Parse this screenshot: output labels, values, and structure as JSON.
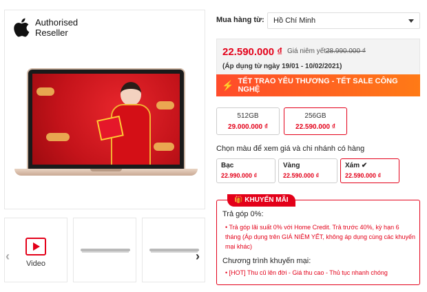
{
  "reseller": {
    "line1": "Authorised",
    "line2": "Reseller"
  },
  "thumbs": {
    "video_label": "Video"
  },
  "store": {
    "label": "Mua hàng từ:",
    "value": "Hồ Chí Minh"
  },
  "price": {
    "main": "22.590.000 ₫",
    "list_label": "Giá niêm yết :",
    "list_value": "28.990.000 ₫",
    "apply_note": "(Áp dụng từ ngày 19/01 - 10/02/2021)"
  },
  "banner": {
    "text": "TẾT TRAO YÊU THƯƠNG - TẾT SALE CÔNG NGHỆ"
  },
  "options": [
    {
      "name": "512GB",
      "price": "29.000.000 ₫"
    },
    {
      "name": "256GB",
      "price": "22.590.000 ₫"
    }
  ],
  "color_label": "Chọn màu để xem giá và chi nhánh có hàng",
  "colors": [
    {
      "name": "Bạc",
      "price": "22.990.000 ₫"
    },
    {
      "name": "Vàng",
      "price": "22.590.000 ₫"
    },
    {
      "name": "Xám ✔",
      "price": "22.590.000 ₫"
    }
  ],
  "promo": {
    "tab": "🎁 KHUYẾN MÃI",
    "h1": "Trả góp 0%:",
    "b1": "• Trả góp lãi suất 0% với Home Credit. Trả trước 40%, kỳ hạn 6 tháng (Áp dụng trên GIÁ NIÊM YẾT, không áp dụng cùng các khuyến mại khác)",
    "h2": "Chương trình khuyến mại:",
    "b2": "• [HOT] Thu cũ lên đời - Giá thu cao - Thủ tục nhanh chóng"
  }
}
